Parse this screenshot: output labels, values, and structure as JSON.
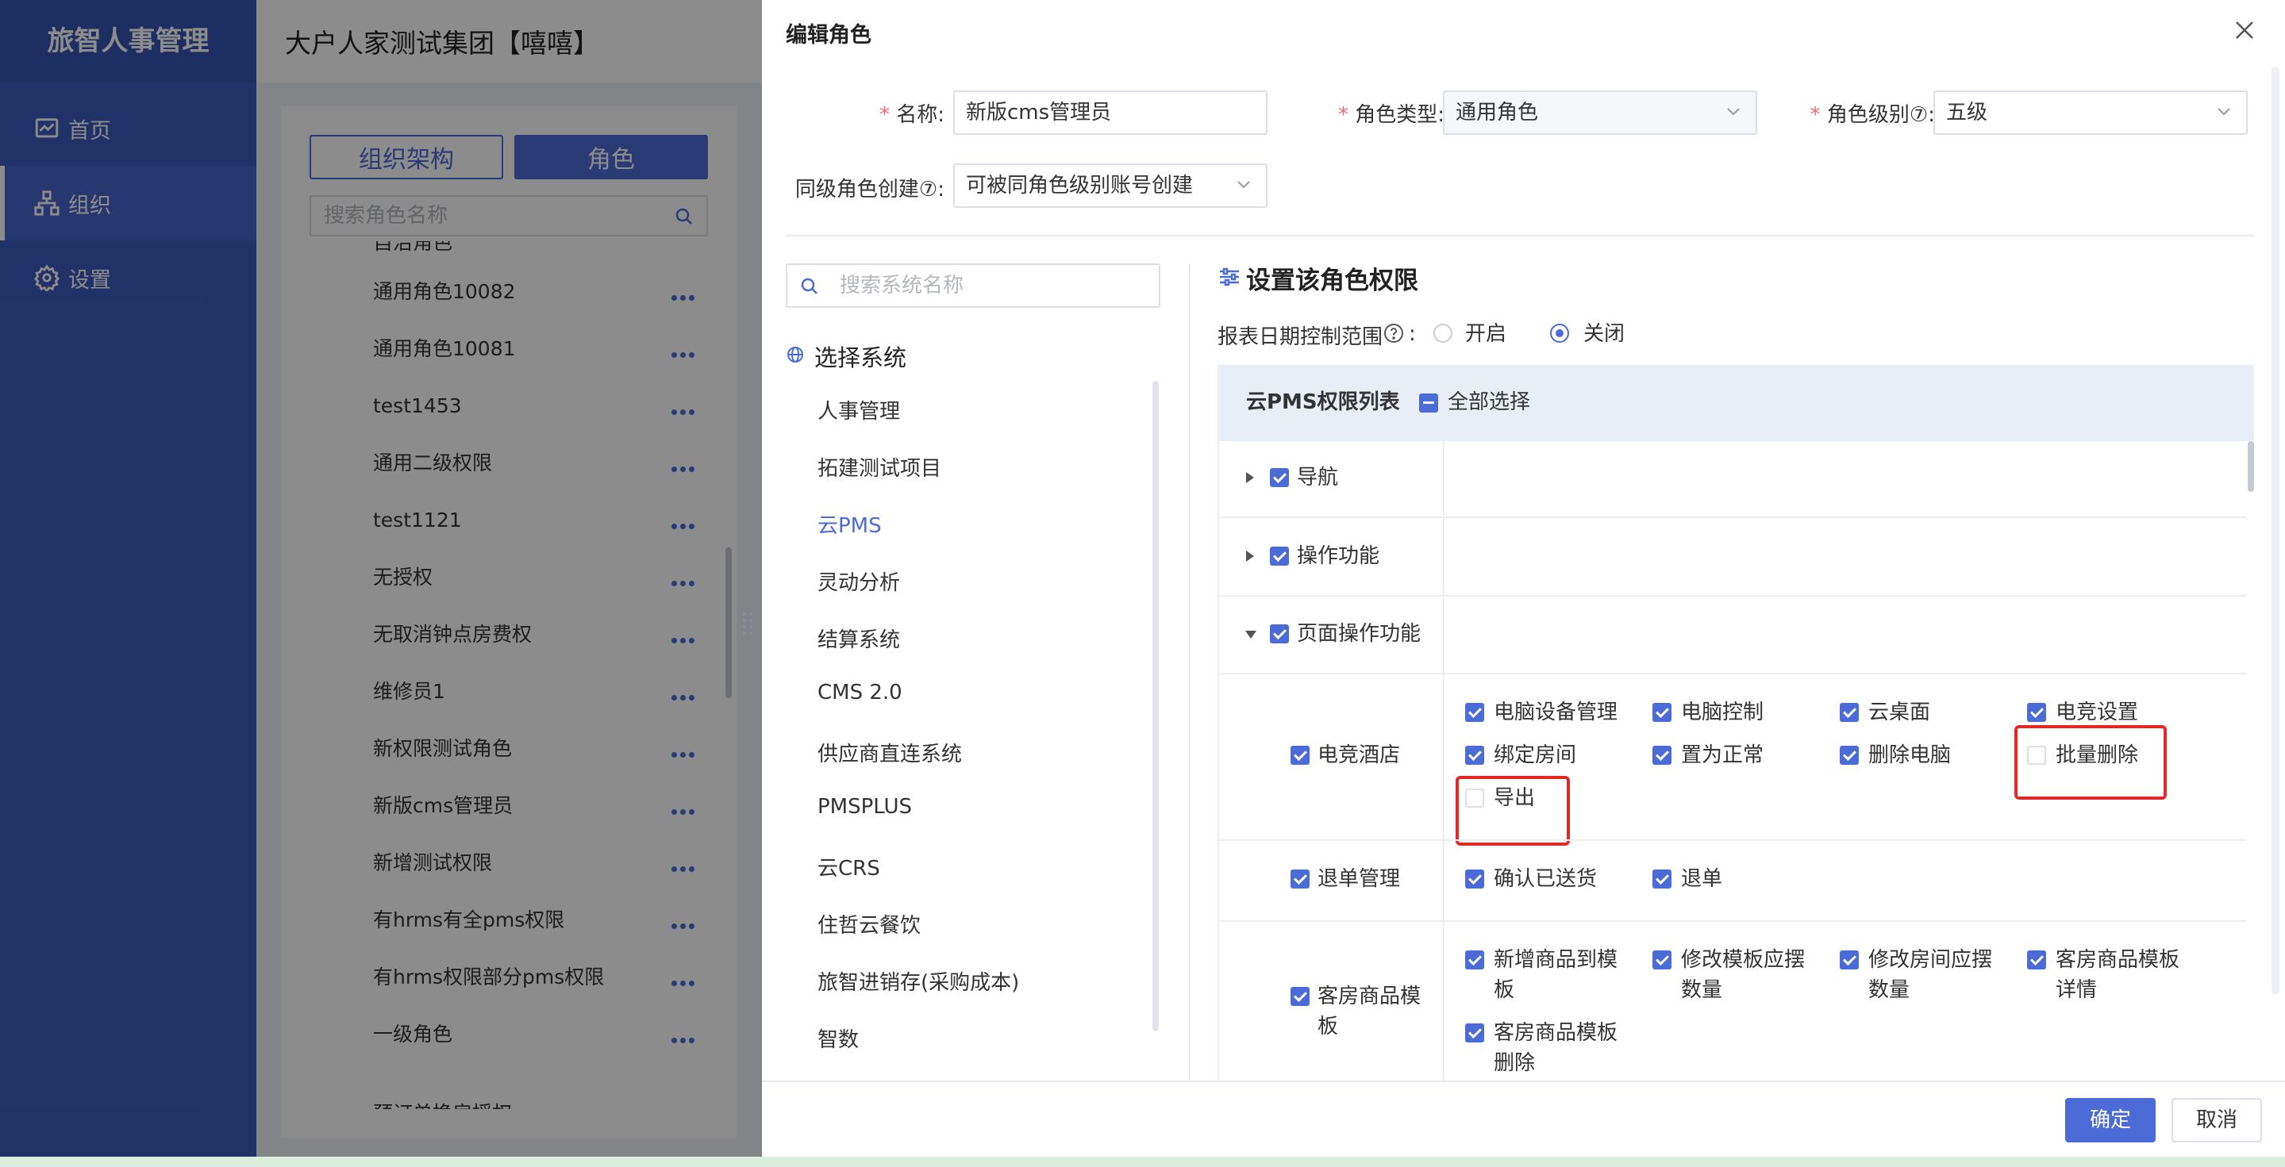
{
  "app": {
    "logo": "旅智人事管理",
    "company": "大户人家测试集团【嘻嘻】"
  },
  "sidebar": {
    "items": [
      {
        "label": "首页",
        "icon": "chart-icon"
      },
      {
        "label": "组织",
        "icon": "org-icon"
      },
      {
        "label": "设置",
        "icon": "gear-icon"
      }
    ]
  },
  "rolePanel": {
    "tabs": [
      "组织架构",
      "角色"
    ],
    "searchPlaceholder": "搜索角色名称",
    "cutTop": "自治角色",
    "roles": [
      "通用角色10082",
      "通用角色10081",
      "test1453",
      "通用二级权限",
      "test1121",
      "无授权",
      "无取消钟点房费权",
      "维修员1",
      "新权限测试角色",
      "新版cms管理员",
      "新增测试权限",
      "有hrms有全pms权限",
      "有hrms权限部分pms权限",
      "一级角色"
    ],
    "cutBottom": "预订单换房授权"
  },
  "dialog": {
    "title": "编辑角色",
    "form": {
      "nameLabel": "名称:",
      "nameValue": "新版cms管理员",
      "typeLabel": "角色类型:",
      "typeValue": "通用角色",
      "levelLabel": "角色级别⑦:",
      "levelValue": "五级",
      "sameLabel": "同级角色创建⑦:",
      "sameValue": "可被同角色级别账号创建"
    },
    "systemSearchPlaceholder": "搜索系统名称",
    "systemTitle": "选择系统",
    "systems": [
      "人事管理",
      "拓建测试项目",
      "云PMS",
      "灵动分析",
      "结算系统",
      "CMS 2.0",
      "供应商直连系统",
      "PMSPLUS",
      "云CRS",
      "住哲云餐饮",
      "旅智进销存(采购成本)",
      "智数"
    ],
    "activeSystem": "云PMS",
    "permTitle": "设置该角色权限",
    "dateRange": {
      "label": "报表日期控制范围",
      "on": "开启",
      "off": "关闭",
      "selected": "关闭"
    },
    "table": {
      "head": "云PMS权限列表",
      "selectAll": "全部选择",
      "groups": [
        "导航",
        "操作功能",
        "页面操作功能"
      ],
      "rows": [
        {
          "name": "电竞酒店",
          "perms": [
            "电脑设备管理",
            "电脑控制",
            "云桌面",
            "电竞设置",
            "绑定房间",
            "置为正常",
            "删除电脑",
            "批量删除",
            "导出"
          ],
          "unchecked": [
            "批量删除",
            "导出"
          ]
        },
        {
          "name": "退单管理",
          "perms": [
            "确认已送货",
            "退单"
          ]
        },
        {
          "name1": "客房商品模",
          "name2": "板",
          "perms": [
            {
              "l1": "新增商品到模",
              "l2": "板"
            },
            {
              "l1": "修改模板应摆",
              "l2": "数量"
            },
            {
              "l1": "修改房间应摆",
              "l2": "数量"
            },
            {
              "l1": "客房商品模板",
              "l2": "详情"
            },
            {
              "l1": "客房商品模板",
              "l2": "删除"
            }
          ]
        }
      ]
    },
    "buttons": {
      "ok": "确定",
      "cancel": "取消"
    }
  },
  "colors": {
    "primary": "#4b6bd6",
    "nav": "#3d5cbf",
    "highlight": "#e02a2a"
  }
}
